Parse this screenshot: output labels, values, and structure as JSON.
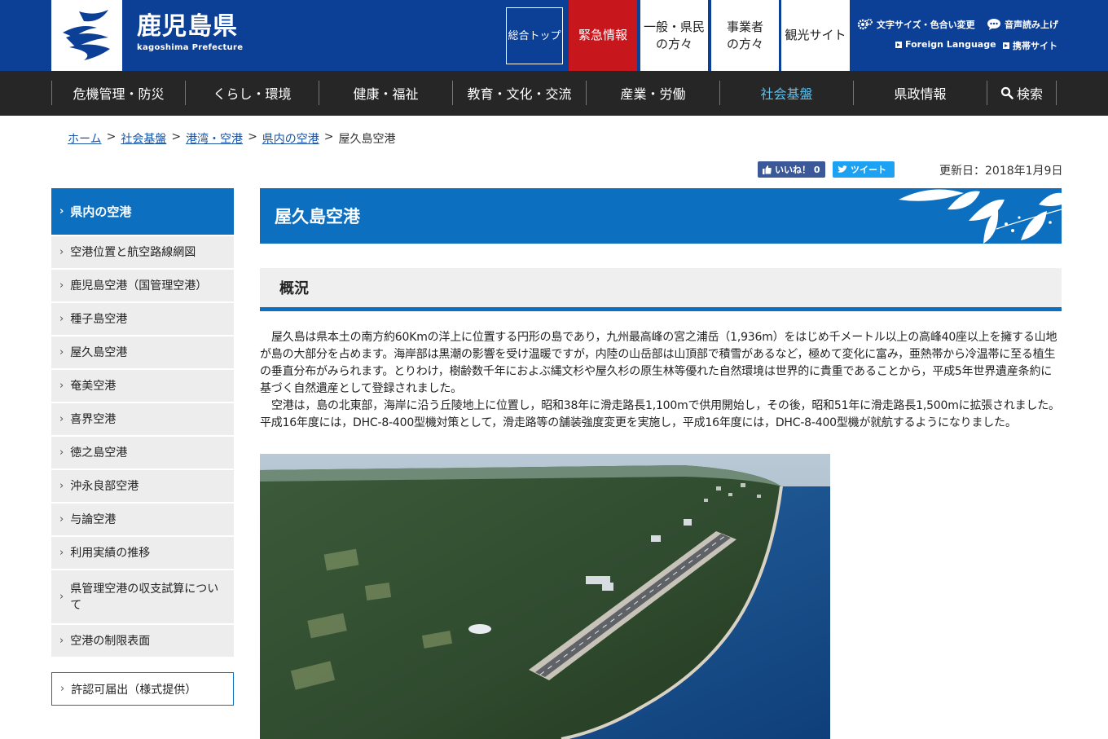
{
  "header": {
    "logo_ja": "鹿児島県",
    "logo_en": "kagoshima Prefecture",
    "top_label": "総合トップ",
    "emergency_label": "緊急情報",
    "general_label": "一般・県民\nの方々",
    "business_label": "事業者\nの方々",
    "tourism_label": "観光サイト",
    "font_label": "文字サイズ・色合い変更",
    "voice_label": "音声読み上げ",
    "lang_label": "Foreign Language",
    "mobile_label": "携帯サイト"
  },
  "gnav": {
    "items": [
      "危機管理・防災",
      "くらし・環境",
      "健康・福祉",
      "教育・文化・交流",
      "産業・労働",
      "社会基盤",
      "県政情報",
      "検索"
    ]
  },
  "breadcrumb": [
    "ホーム",
    "社会基盤",
    "港湾・空港",
    "県内の空港",
    "屋久島空港"
  ],
  "share": {
    "like": "いいね！ 0",
    "tweet": "ツイート"
  },
  "updated": "更新日：2018年1月9日",
  "sidebar": {
    "title": "県内の空港",
    "items": [
      "空港位置と航空路線網図",
      "鹿児島空港（国管理空港）",
      "種子島空港",
      "屋久島空港",
      "奄美空港",
      "喜界空港",
      "徳之島空港",
      "沖永良部空港",
      "与論空港",
      "利用実績の推移",
      "県管理空港の収支試算について",
      "空港の制限表面"
    ],
    "permit": "許認可届出（様式提供）"
  },
  "main": {
    "title": "屋久島空港",
    "section": "概況",
    "para1": "屋久島は県本土の南方約60Kmの洋上に位置する円形の島であり，九州最高峰の宮之浦岳（1,936m）をはじめ千メートル以上の高峰40座以上を擁する山地が島の大部分を占めます。海岸部は黒潮の影響を受け温暖ですが，内陸の山岳部は山頂部で積雪があるなど，極めて変化に富み，亜熱帯から冷温帯に至る植生の垂直分布がみられます。とりわけ，樹齢数千年におよぶ縄文杉や屋久杉の原生林等優れた自然環境は世界的に貴重であることから，平成5年世界遺産条約に基づく自然遺産として登録されました。",
    "para2": "空港は，島の北東部，海岸に沿う丘陵地上に位置し，昭和38年に滑走路長1,100mで供用開始し，その後，昭和51年に滑走路長1,500mに拡張されました。平成16年度には，DHC-8-400型機対策として，滑走路等の舗装強度変更を実施し，平成16年度には，DHC-8-400型機が就航するようになりました。"
  },
  "colors": {
    "header": "#0c3f96",
    "emergency": "#c8161d",
    "nav": "#262626",
    "accent": "#0c6fc0",
    "active": "#5fc0ec"
  }
}
